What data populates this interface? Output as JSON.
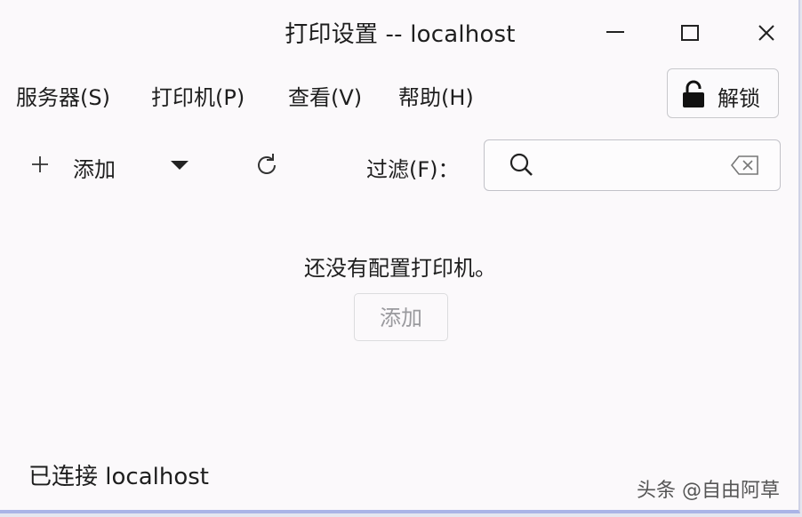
{
  "window": {
    "title": "打印设置 -- localhost",
    "controls": [
      "minimize-icon",
      "maximize-icon",
      "close-icon"
    ]
  },
  "menubar": {
    "items": [
      {
        "label": "服务器(S)"
      },
      {
        "label": "打印机(P)"
      },
      {
        "label": "查看(V)"
      },
      {
        "label": "帮助(H)"
      }
    ],
    "unlock": {
      "label": "解锁",
      "icon": "lock-open-icon"
    }
  },
  "toolbar": {
    "add": {
      "icon": "plus-icon",
      "label": "添加"
    },
    "dropdown_icon": "triangle-down-icon",
    "refresh_icon": "refresh-icon",
    "filter_label": "过滤(F)：",
    "search": {
      "value": "",
      "placeholder": "",
      "icon": "search-icon",
      "clear_icon": "backspace-clear-icon"
    }
  },
  "empty_state": {
    "message": "还没有配置打印机。",
    "add_button_label": "添加"
  },
  "statusbar": {
    "text": "已连接 localhost"
  },
  "watermark": {
    "text": "头条 @自由阿草"
  },
  "colors": {
    "window_bg": "#fbf9fb",
    "text": "#1e1e1e",
    "disabled_text": "#9a9a9e",
    "border": "#c8c8cc"
  }
}
